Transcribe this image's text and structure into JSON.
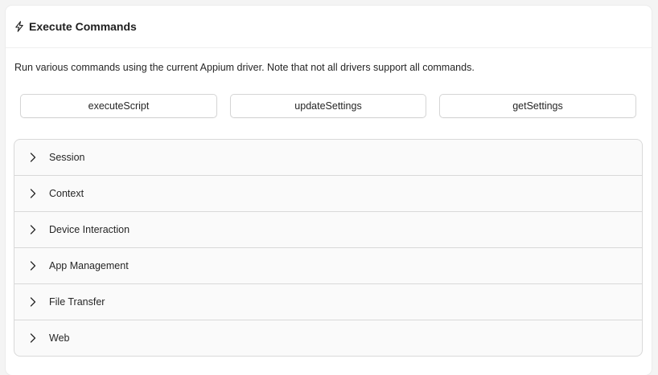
{
  "header": {
    "title": "Execute Commands",
    "icon": "lightning-icon"
  },
  "description": "Run various commands using the current Appium driver. Note that not all drivers support all commands.",
  "buttons": [
    {
      "label": "executeScript"
    },
    {
      "label": "updateSettings"
    },
    {
      "label": "getSettings"
    }
  ],
  "sections": [
    {
      "label": "Session",
      "icon": "chevron-right-icon"
    },
    {
      "label": "Context",
      "icon": "chevron-right-icon"
    },
    {
      "label": "Device Interaction",
      "icon": "chevron-right-icon"
    },
    {
      "label": "App Management",
      "icon": "chevron-right-icon"
    },
    {
      "label": "File Transfer",
      "icon": "chevron-right-icon"
    },
    {
      "label": "Web",
      "icon": "chevron-right-icon"
    }
  ],
  "colors": {
    "panel_bg": "#fafafa",
    "border": "#d9d9d9",
    "text": "#262626"
  }
}
